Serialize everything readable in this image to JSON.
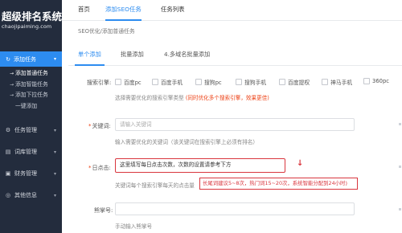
{
  "sidebar": {
    "logo_title": "超级排名系统",
    "logo_subtitle": "chaojipaiming.com",
    "active_menu": {
      "label": "添加任务",
      "icon": "refresh-icon"
    },
    "sub_items": [
      {
        "label": "添加普通任务",
        "active": true
      },
      {
        "label": "添加智能任务",
        "active": false
      },
      {
        "label": "添加下拉任务",
        "active": false
      },
      {
        "label": "一键添加",
        "active": false
      }
    ],
    "menu": [
      {
        "label": "任务管理",
        "icon": "gear-icon"
      },
      {
        "label": "词库管理",
        "icon": "book-icon"
      },
      {
        "label": "财务管理",
        "icon": "money-icon"
      },
      {
        "label": "其他信息",
        "icon": "globe-icon"
      }
    ]
  },
  "topnav": {
    "items": [
      {
        "label": "首页",
        "active": false
      },
      {
        "label": "添加SEO任务",
        "active": true
      },
      {
        "label": "任务列表",
        "active": false
      }
    ]
  },
  "breadcrumb": "SEO优化/添加普通任务",
  "tabs": [
    {
      "label": "单个添加",
      "active": true
    },
    {
      "label": "批量添加",
      "active": false
    },
    {
      "label": "4.多域名批量添加",
      "active": false
    }
  ],
  "form": {
    "engine": {
      "label": "搜索引擎:",
      "options": [
        "百度pc",
        "百度手机",
        "搜狗pc",
        "搜狗手机",
        "百度提权",
        "神马手机",
        "360pc"
      ],
      "help_prefix": "选择需要优化的搜索引擎类型 ",
      "help_red": "(同时优化多个搜索引擎，效果更佳)"
    },
    "keyword": {
      "label": "关键词:",
      "placeholder": "请输入关键词",
      "help": "输入需要优化的关键词（该关键词在搜索引擎上必须有排名）"
    },
    "clicks": {
      "label": "日点击:",
      "value": "这里填写每日点击次数，次数的设置请参考下方",
      "help": "关键词每个搜索引擎每天的点击量",
      "annotation": "长尾词建议5~8次，热门词15~20次，系统智能分配到24小时)"
    },
    "bear": {
      "label": "熊掌号:",
      "help": "手动输入熊掌号"
    }
  },
  "colors": {
    "sidebar_bg": "#232c3d",
    "accent": "#2d8cf0",
    "annotation_red": "#d9363e"
  }
}
